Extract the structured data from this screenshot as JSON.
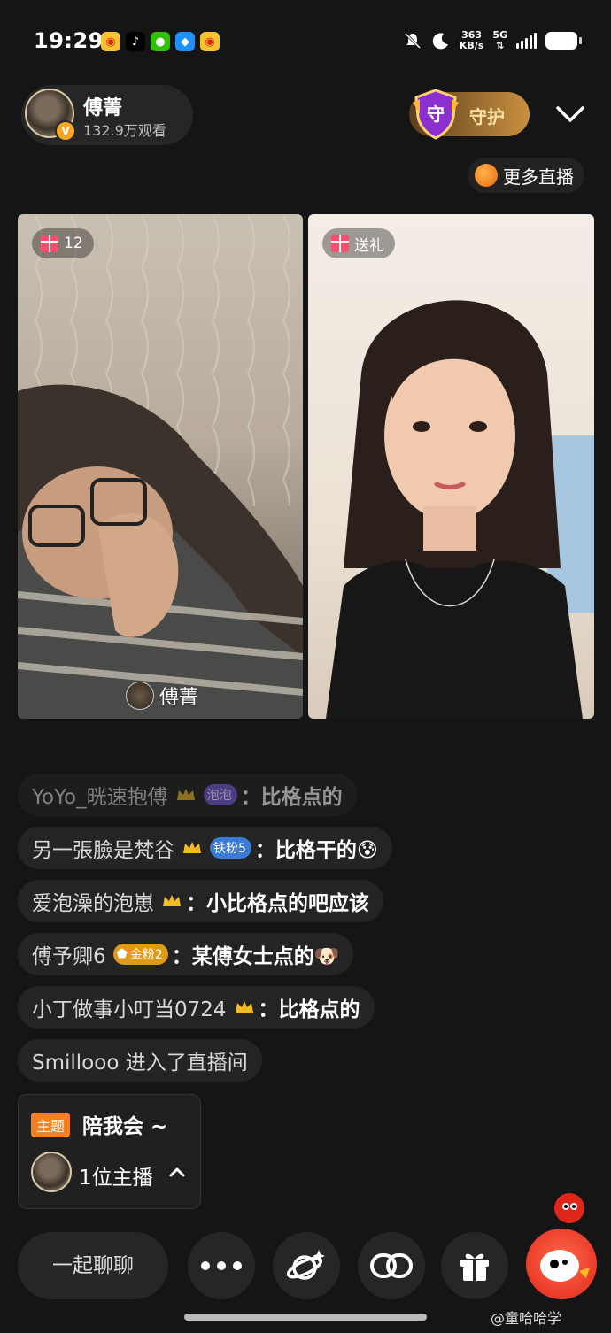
{
  "status": {
    "time": "19:29",
    "net_speed": "363",
    "net_unit": "KB/s",
    "net_type": "5G"
  },
  "host": {
    "name": "傅菁",
    "views": "132.9万观看"
  },
  "guard": {
    "label": "守护",
    "shield_char": "守"
  },
  "more_live": "更多直播",
  "panels": {
    "left_gift_count": "12",
    "left_name": "傅菁",
    "right_gift_label": "送礼"
  },
  "chat": [
    {
      "user": "YoYo_晄速抱傅",
      "badge": "泡泡",
      "msg": "比格点的"
    },
    {
      "user": "另一張臉是梵谷",
      "badge": "铁粉5",
      "msg": "比格干的😰"
    },
    {
      "user": "爱泡澡的泡崽",
      "badge": "",
      "msg": "小比格点的吧应该"
    },
    {
      "user": "傅予卿6",
      "badge": "金粉2",
      "msg": "某傅女士点的🐶"
    },
    {
      "user": "小丁做事小叮当0724",
      "badge": "",
      "msg": "比格点的"
    },
    {
      "system": "Smillooo 进入了直播间"
    }
  ],
  "topic": {
    "tag": "主题",
    "title": "陪我会 ~",
    "host_count": "1位主播"
  },
  "bottom": {
    "chat_placeholder": "一起聊聊"
  },
  "watermark": "@童哈哈学",
  "colors": {
    "accent_orange": "#f5801f",
    "weibo_red": "#e1251b",
    "gold": "#c9913f"
  }
}
